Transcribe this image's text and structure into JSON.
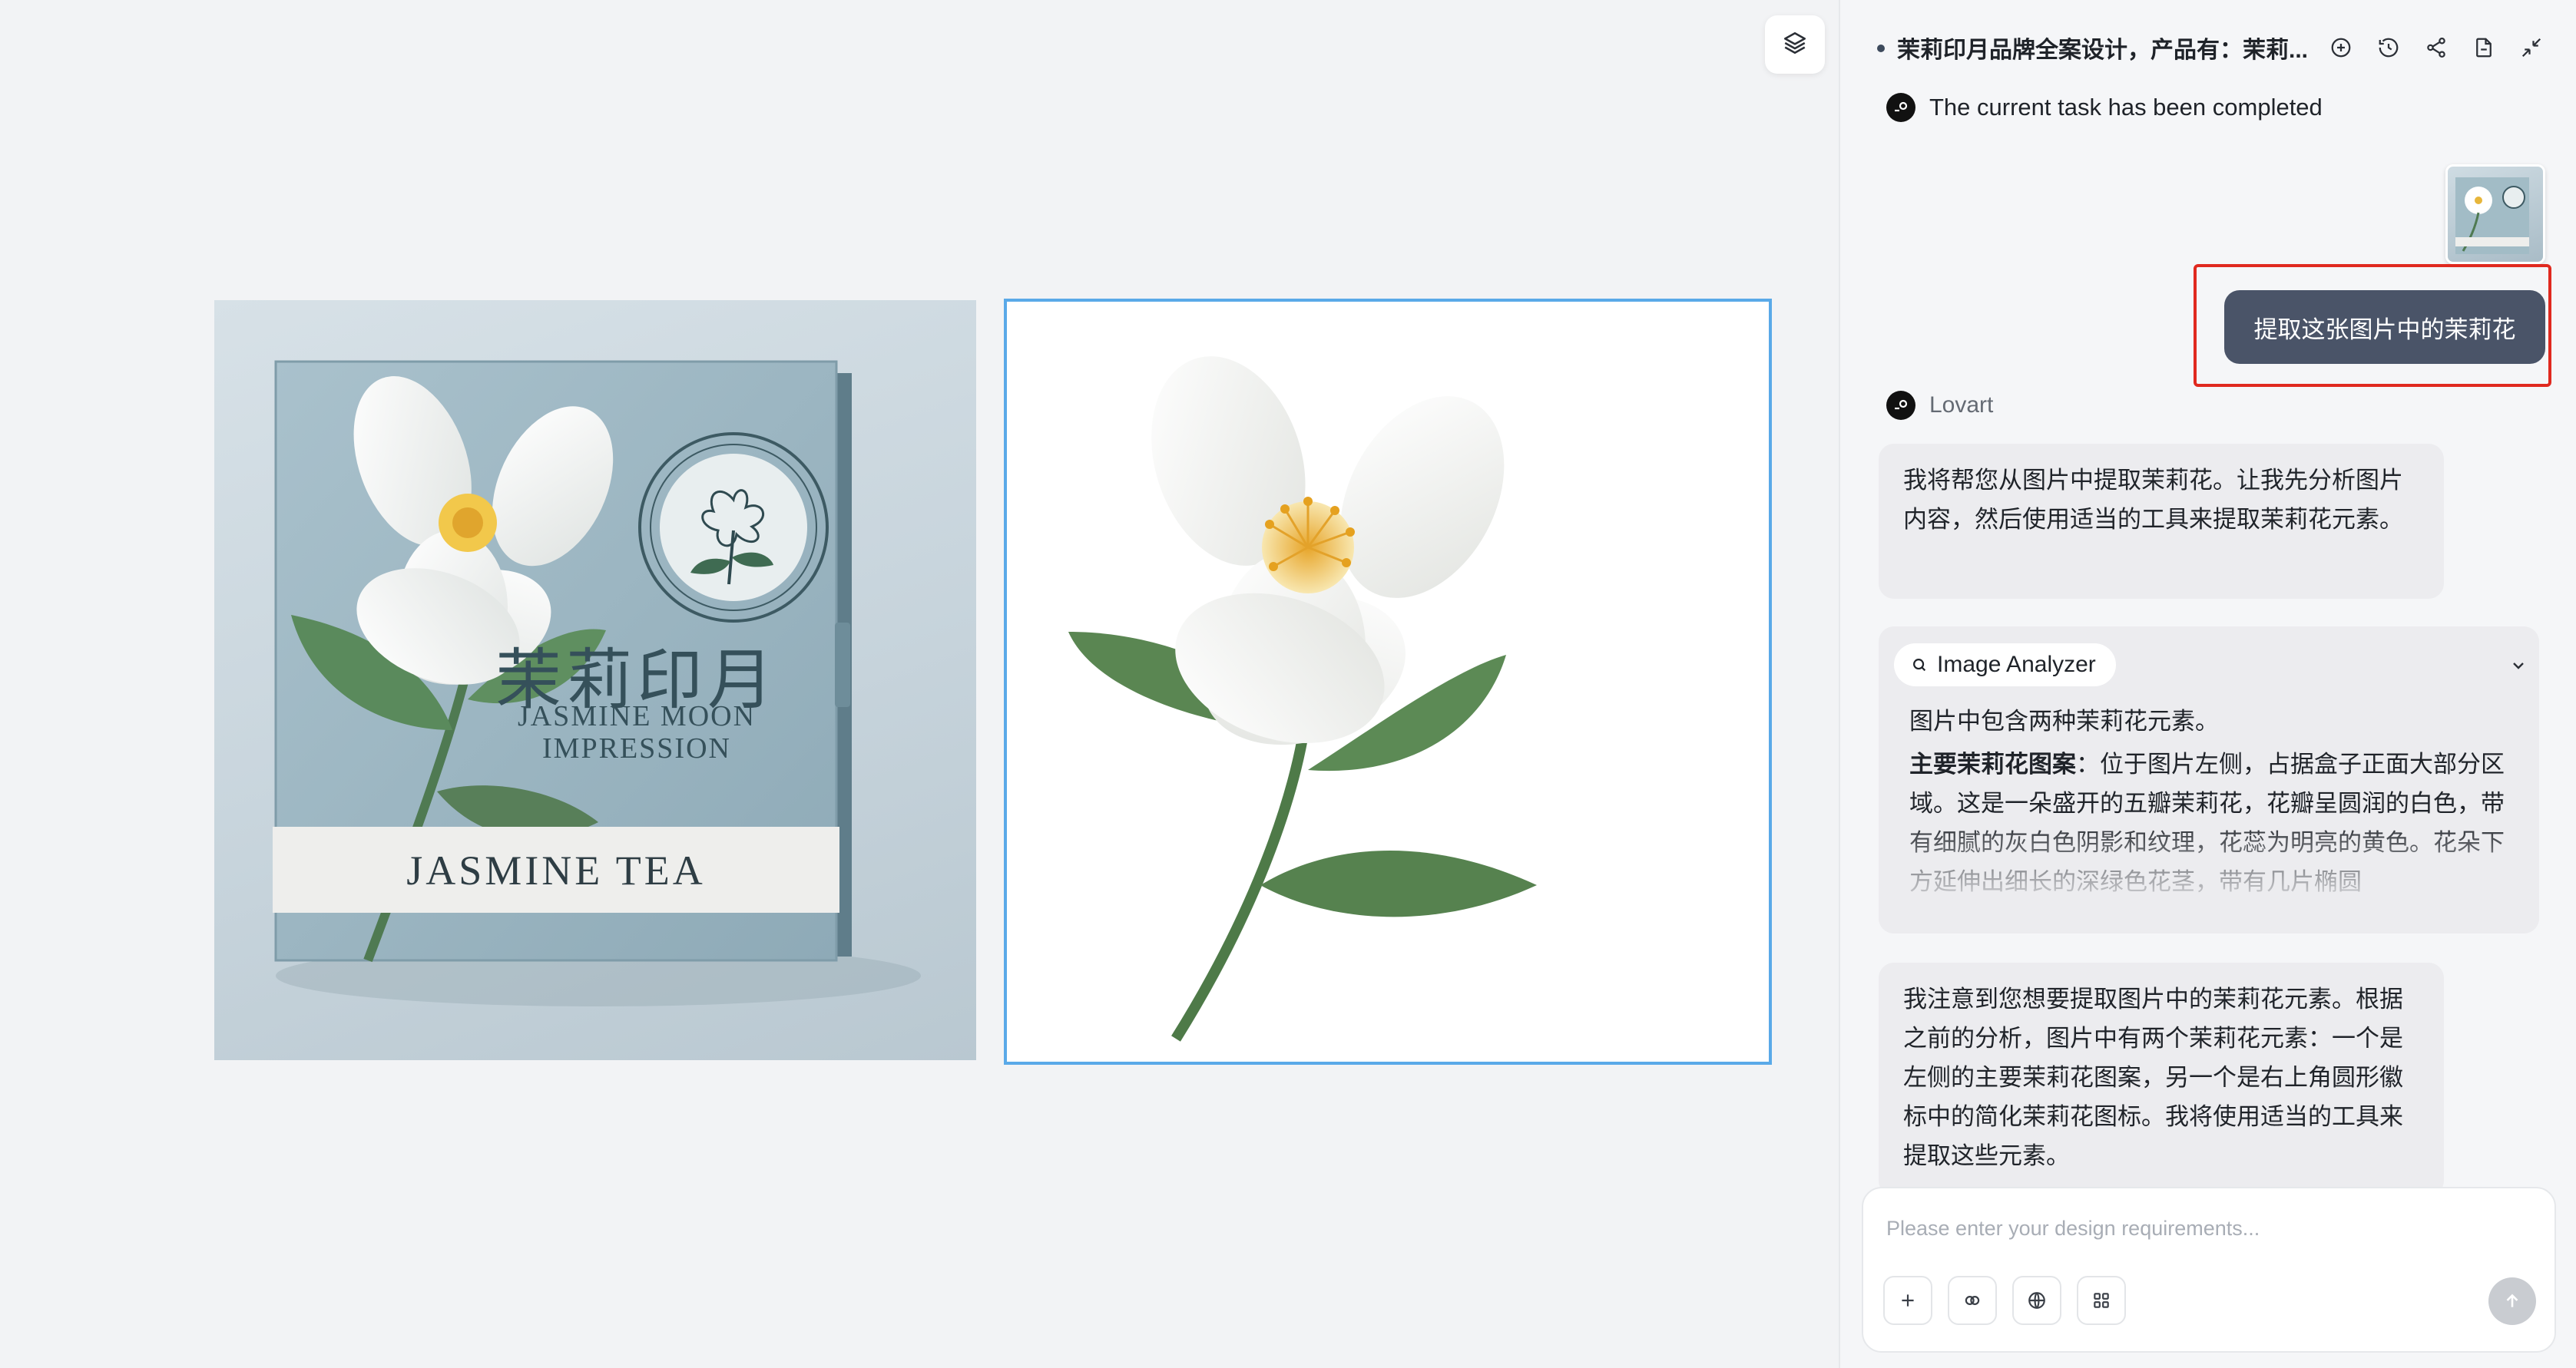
{
  "canvas": {
    "layers_icon": "layers-icon",
    "source_image": {
      "cn_title": "茉莉印月",
      "en_line1": "JASMINE MOON",
      "en_line2": "IMPRESSION",
      "band_text": "JASMINE TEA"
    },
    "selection_color": "#5aa9e8"
  },
  "panel": {
    "title": "茉莉印月品牌全案设计，产品有：茉莉...",
    "header_icons": [
      "add-chat-icon",
      "history-icon",
      "share-icon",
      "export-icon",
      "collapse-icon"
    ],
    "status_text": "The current task has been completed",
    "user_message": "提取这张图片中的茉莉花",
    "highlight_color": "#e0291f",
    "bot_name": "Lovart",
    "bot_message_1": "我将帮您从图片中提取茉莉花。让我先分析图片内容，然后使用适当的工具来提取茉莉花元素。",
    "tool": {
      "name": "Image Analyzer",
      "summary": "图片中包含两种茉莉花元素。",
      "detail_label": "主要茉莉花图案",
      "detail_text": "：位于图片左侧，占据盒子正面大部分区域。这是一朵盛开的五瓣茉莉花，花瓣呈圆润的白色，带有细腻的灰白色阴影和纹理，花蕊为明亮的黄色。花朵下方延伸出细长的深绿色花茎，带有几片椭圆"
    },
    "bot_message_2": "我注意到您想要提取图片中的茉莉花元素。根据之前的分析，图片中有两个茉莉花元素：一个是左侧的主要茉莉花图案，另一个是右上角圆形徽标中的简化茉莉花图标。我将使用适当的工具来提取这些元素。",
    "composer": {
      "placeholder": "Please enter your design requirements...",
      "tools": [
        "plus-icon",
        "link-icon",
        "globe-icon",
        "grid-icon"
      ],
      "send_icon": "send-arrow-icon"
    }
  }
}
